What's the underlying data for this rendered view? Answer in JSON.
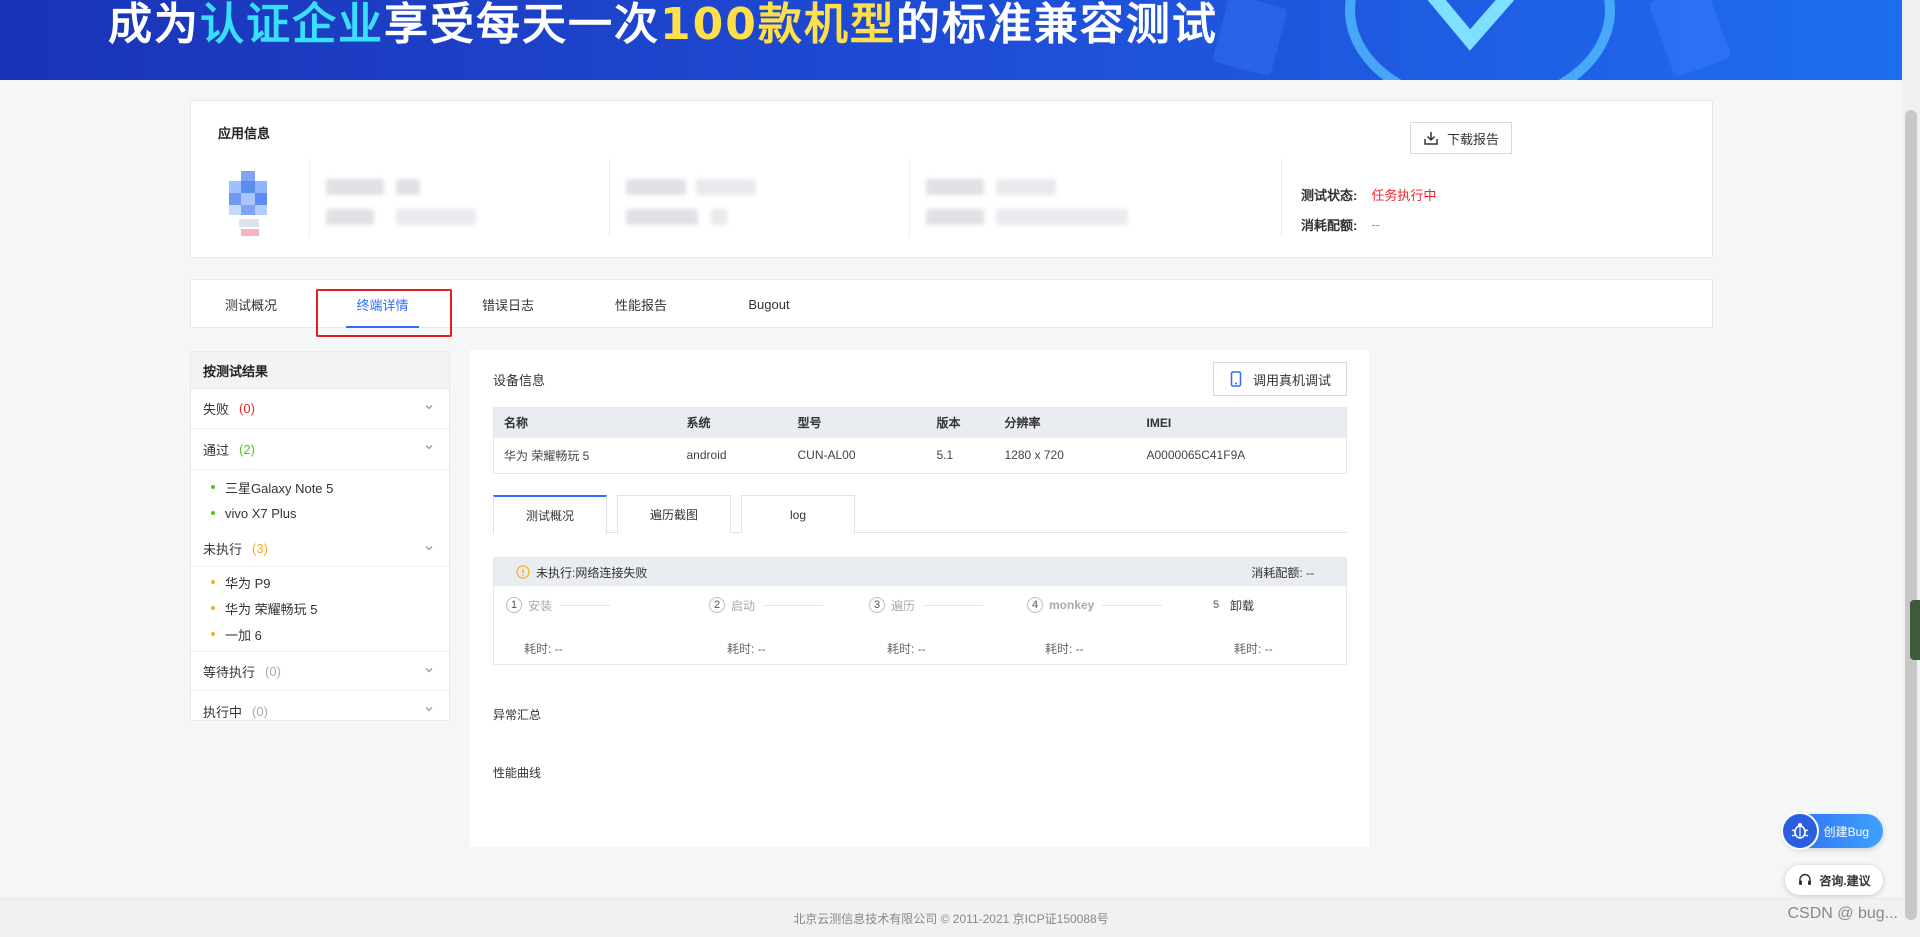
{
  "banner": {
    "text_before": "成为",
    "text_hl1": "认证企业",
    "text_mid": "享受每天一次",
    "text_hl2": "100款机型",
    "text_after": "的标准兼容测试"
  },
  "app_info": {
    "title": "应用信息",
    "download_label": "下载报告",
    "status_label": "测试状态:",
    "status_value": "任务执行中",
    "quota_label": "消耗配额:",
    "quota_value": "--"
  },
  "tabs": [
    {
      "label": "测试概况"
    },
    {
      "label": "终端详情"
    },
    {
      "label": "错误日志"
    },
    {
      "label": "性能报告"
    },
    {
      "label": "Bugout"
    }
  ],
  "results": {
    "header": "按测试结果",
    "groups": {
      "fail": {
        "label": "失败",
        "count": "(0)"
      },
      "pass": {
        "label": "通过",
        "count": "(2)",
        "items": [
          "三星Galaxy Note 5",
          "vivo X7 Plus"
        ]
      },
      "notrun": {
        "label": "未执行",
        "count": "(3)",
        "items": [
          "华为 P9",
          "华为 荣耀畅玩 5",
          "一加 6"
        ]
      },
      "waiting": {
        "label": "等待执行",
        "count": "(0)"
      },
      "running": {
        "label": "执行中",
        "count": "(0)"
      }
    }
  },
  "device": {
    "title": "设备信息",
    "debug_label": "调用真机调试",
    "columns": [
      "名称",
      "系统",
      "型号",
      "版本",
      "分辨率",
      "IMEI"
    ],
    "row": [
      "华为 荣耀畅玩 5",
      "android",
      "CUN-AL00",
      "5.1",
      "1280 x 720",
      "A0000065C41F9A"
    ]
  },
  "sub_tabs": [
    {
      "label": "测试概况"
    },
    {
      "label": "遍历截图"
    },
    {
      "label": "log"
    }
  ],
  "execution": {
    "status": "未执行:网络连接失败",
    "quota": "消耗配额: --",
    "steps": [
      {
        "num": "1",
        "label": "安装",
        "time": "耗时: --"
      },
      {
        "num": "2",
        "label": "启动",
        "time": "耗时: --"
      },
      {
        "num": "3",
        "label": "遍历",
        "time": "耗时: --"
      },
      {
        "num": "4",
        "label": "monkey",
        "time": "耗时: --"
      },
      {
        "num": "5",
        "label": "卸载",
        "time": "耗时: --"
      }
    ]
  },
  "sections": {
    "exceptions": "异常汇总",
    "performance": "性能曲线"
  },
  "footer": {
    "text": "北京云测信息技术有限公司 © 2011-2021 京ICP证150088号",
    "watermark": "CSDN @ bug..."
  },
  "floats": {
    "create_bug": "创建Bug",
    "consult": "咨询.建议"
  },
  "colors": {
    "accent": "#2f6bff",
    "fail": "#f5222d",
    "pass": "#52c41a",
    "notrun": "#faad14"
  }
}
